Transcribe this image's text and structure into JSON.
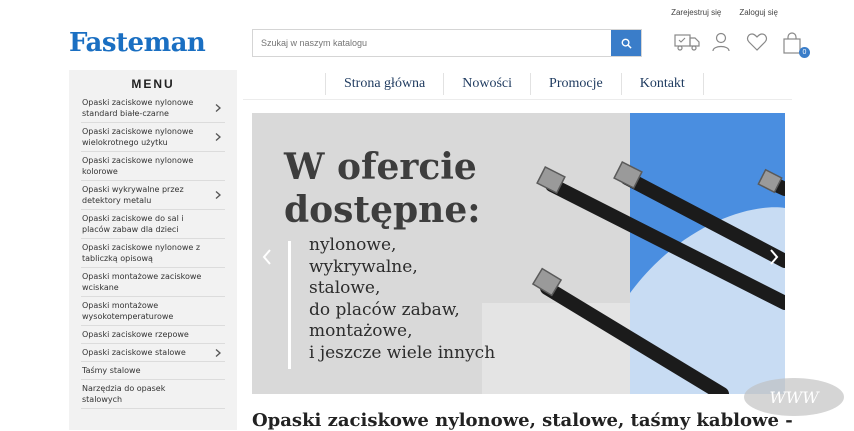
{
  "topbar": {
    "register": "Zarejestruj się",
    "login": "Zaloguj się"
  },
  "logo": "Fasteman",
  "search": {
    "placeholder": "Szukaj w naszym katalogu"
  },
  "cart": {
    "count": "0"
  },
  "sidebar": {
    "title": "MENU",
    "items": [
      {
        "label": "Opaski zaciskowe nylonowe standard białe-czarne",
        "has_sub": true
      },
      {
        "label": "Opaski zaciskowe nylonowe wielokrotnego użytku",
        "has_sub": true
      },
      {
        "label": "Opaski zaciskowe nylonowe kolorowe",
        "has_sub": false
      },
      {
        "label": "Opaski wykrywalne przez detektory metalu",
        "has_sub": true
      },
      {
        "label": "Opaski zaciskowe do sal i placów zabaw dla dzieci",
        "has_sub": false
      },
      {
        "label": "Opaski zaciskowe nylonowe z tabliczką opisową",
        "has_sub": false
      },
      {
        "label": "Opaski montażowe zaciskowe wciskane",
        "has_sub": false
      },
      {
        "label": "Opaski montażowe wysokotemperaturowe",
        "has_sub": false
      },
      {
        "label": "Opaski zaciskowe rzepowe",
        "has_sub": false
      },
      {
        "label": "Opaski zaciskowe stalowe",
        "has_sub": true
      },
      {
        "label": "Taśmy stalowe",
        "has_sub": false
      },
      {
        "label": "Narzędzia do opasek stalowych",
        "has_sub": false
      }
    ]
  },
  "nav": [
    "Strona główna",
    "Nowości",
    "Promocje",
    "Kontakt"
  ],
  "hero": {
    "title_line1": "W ofercie",
    "title_line2": "dostępne:",
    "lines": [
      "nylonowe,",
      "wykrywalne,",
      "stalowe,",
      "do placów zabaw,",
      "montażowe,",
      "i jeszcze wiele innych"
    ]
  },
  "page_heading": "Opaski zaciskowe nylonowe, stalowe, taśmy kablowe -",
  "watermark": "WWW",
  "colors": {
    "brand": "#1a6fc2",
    "accent": "#3a7dc9",
    "hero_blue": "#4a8ee0"
  }
}
